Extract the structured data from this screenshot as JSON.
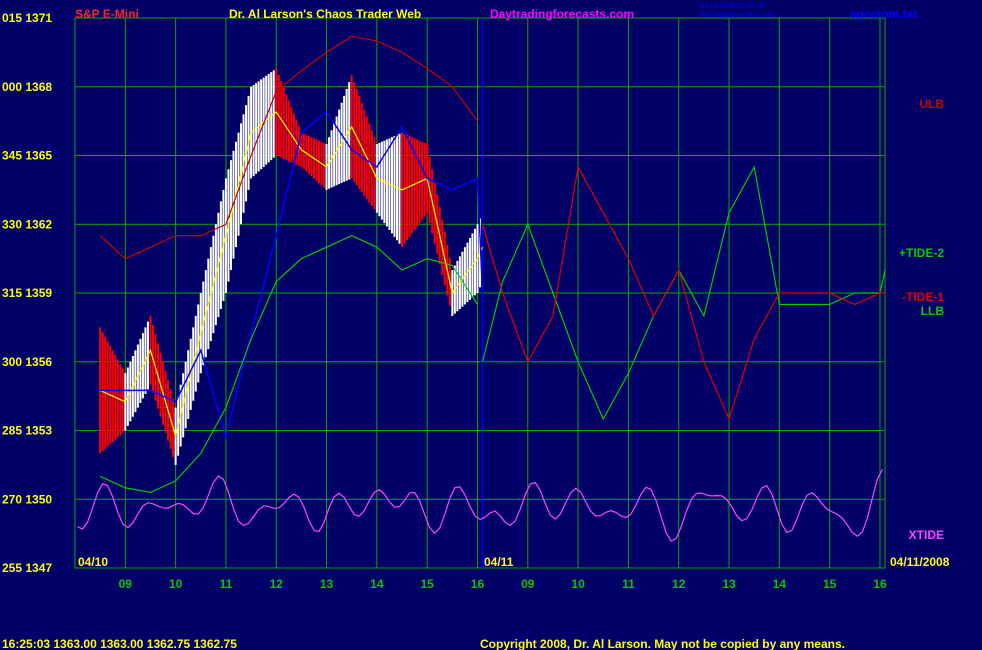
{
  "header": {
    "symbol": "S&P E-Mini",
    "title": "Dr. Al Larson's Chaos Trader Web",
    "site": "Daytradingforecasts.com",
    "file": "spcctom.txt",
    "time_line_1": "04/10/2008 20:30 UT",
    "time_line_2": "04/10/2008 15:30 Local"
  },
  "footer": {
    "quote": "16:25:03  1363.00 1363.00 1362.75 1362.75",
    "copyright": "Copyright 2008, Dr. Al Larson. May not be copied by any means."
  },
  "colors": {
    "background": "#000066",
    "grid": "#00aa00",
    "price_up": "#ffffff",
    "price_down": "#ff0000",
    "average": "#ffff00",
    "long_average": "#0000ff",
    "upper_band": "#cc0000",
    "lower_band": "#00cc00",
    "tide_2": "#00cc00",
    "tide_1": "#dd0000",
    "xtide": "#ff44ff",
    "symbol_text": "#ff2222",
    "title_text": "#ffff00",
    "site_text": "#ff00ff",
    "file_text": "#0000ff",
    "axis_text": "#ffff00"
  },
  "chart_data": {
    "type": "line",
    "title": "S&P E-Mini",
    "y_axis_labels": [
      {
        "left": "015",
        "right": "1371"
      },
      {
        "left": "000",
        "right": "1368"
      },
      {
        "left": "345",
        "right": "1365"
      },
      {
        "left": "330",
        "right": "1362"
      },
      {
        "left": "315",
        "right": "1359"
      },
      {
        "left": "300",
        "right": "1356"
      },
      {
        "left": "285",
        "right": "1353"
      },
      {
        "left": "270",
        "right": "1350"
      },
      {
        "left": "255",
        "right": "1347"
      }
    ],
    "ylim": [
      1347,
      1371
    ],
    "x_ticks": [
      "09",
      "10",
      "11",
      "12",
      "13",
      "14",
      "15",
      "16",
      "09",
      "10",
      "11",
      "12",
      "13",
      "14",
      "15",
      "16"
    ],
    "date_labels": [
      "04/10",
      "04/11",
      "04/11/2008"
    ],
    "right_labels": [
      "ULB",
      "+TIDE-2",
      "-TIDE-1",
      "LLB",
      "XTIDE"
    ],
    "grid": true,
    "price_range": {
      "x": [
        8.5,
        9.0,
        9.5,
        10.0,
        10.5,
        11.0,
        11.5,
        12.0,
        12.5,
        13.0,
        13.5,
        14.0,
        14.5,
        15.0,
        15.5,
        16.0,
        16.1
      ],
      "high": [
        1357.5,
        1355.5,
        1358.0,
        1354.0,
        1359.0,
        1364.0,
        1368.0,
        1368.8,
        1366.0,
        1365.5,
        1368.5,
        1365.5,
        1366.0,
        1365.5,
        1360.0,
        1362.0,
        1362.5
      ],
      "low": [
        1352.0,
        1353.0,
        1355.0,
        1351.5,
        1355.5,
        1359.0,
        1364.0,
        1365.0,
        1364.5,
        1363.5,
        1364.0,
        1362.5,
        1361.0,
        1362.5,
        1358.0,
        1359.0,
        1359.5
      ]
    },
    "series": [
      {
        "name": "ULB",
        "x": [
          8.5,
          9.0,
          9.5,
          10.0,
          10.5,
          11.0,
          11.5,
          12.0,
          12.5,
          13.0,
          13.5,
          14.0,
          14.5,
          15.0,
          15.5,
          16.0
        ],
        "values": [
          1361.5,
          1360.5,
          1361.0,
          1361.5,
          1361.5,
          1362.0,
          1365.0,
          1367.8,
          1368.7,
          1369.5,
          1370.2,
          1370.0,
          1369.5,
          1368.8,
          1368.0,
          1366.5
        ]
      },
      {
        "name": "LLB",
        "x": [
          8.5,
          9.0,
          9.5,
          10.0,
          10.5,
          11.0,
          11.5,
          12.0,
          12.5,
          13.0,
          13.5,
          14.0,
          14.5,
          15.0,
          15.5,
          16.0
        ],
        "values": [
          1351.0,
          1350.5,
          1350.3,
          1350.8,
          1352.0,
          1354.0,
          1357.0,
          1359.5,
          1360.5,
          1361.0,
          1361.5,
          1361.0,
          1360.0,
          1360.5,
          1360.2,
          1358.5
        ]
      },
      {
        "name": "+TIDE-2",
        "x": [
          16.1,
          16.5,
          17.0,
          17.5,
          18.0,
          18.5,
          19.0,
          19.5,
          20.0,
          20.5,
          21.0,
          21.5,
          22.0,
          22.5,
          23.0,
          23.5,
          24.0,
          24.1
        ],
        "values": [
          1356.0,
          1359.5,
          1362.0,
          1359.0,
          1356.0,
          1353.5,
          1355.5,
          1358.0,
          1360.0,
          1358.0,
          1362.5,
          1364.5,
          1358.5,
          1358.5,
          1358.5,
          1359.0,
          1359.0,
          1360.0
        ]
      },
      {
        "name": "-TIDE-1",
        "x": [
          16.1,
          16.5,
          17.0,
          17.5,
          18.0,
          18.5,
          19.0,
          19.5,
          20.0,
          20.5,
          21.0,
          21.5,
          22.0,
          22.5,
          23.0,
          23.5,
          24.0,
          24.1
        ],
        "values": [
          1362.0,
          1359.0,
          1356.0,
          1358.0,
          1364.5,
          1362.5,
          1360.5,
          1358.0,
          1360.0,
          1356.0,
          1353.5,
          1357.0,
          1359.0,
          1359.0,
          1359.0,
          1358.5,
          1359.0,
          1359.0
        ]
      }
    ]
  }
}
